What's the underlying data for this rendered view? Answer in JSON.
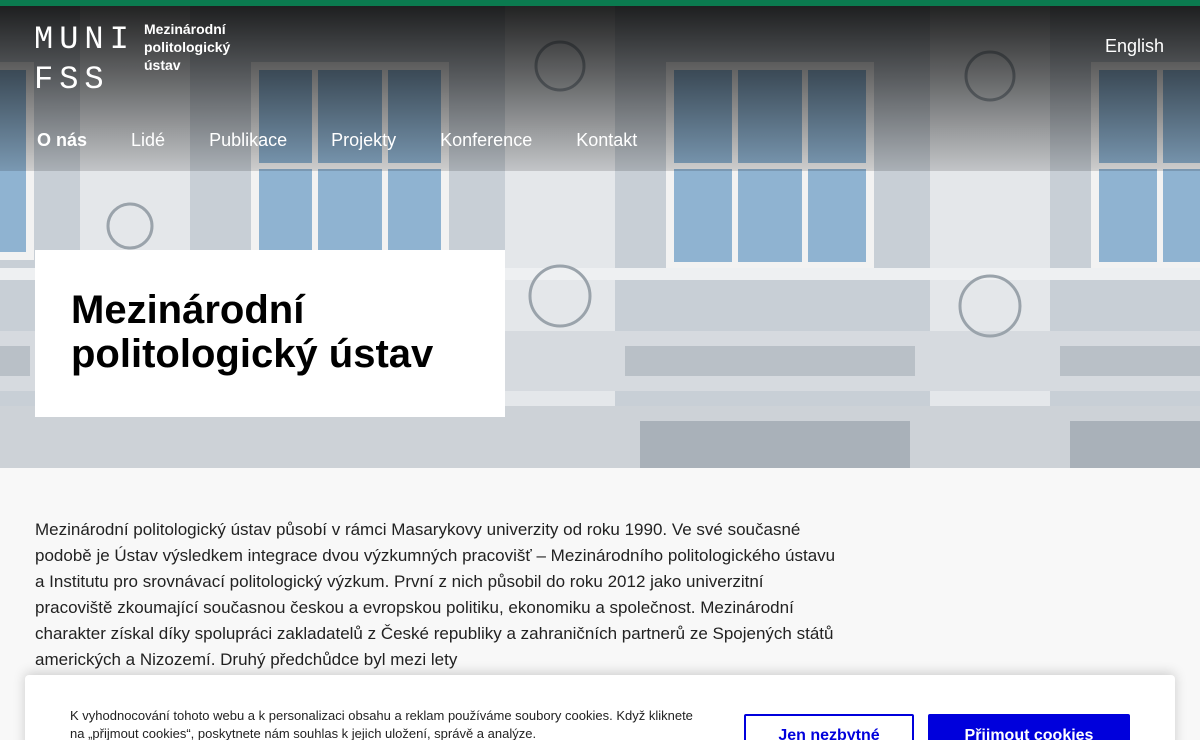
{
  "brand": {
    "logo_line1": "MUNI",
    "logo_line2": "FSS",
    "institute_name": "Mezinárodní politologický ústav",
    "accent_color": "#0b7a4f"
  },
  "header": {
    "language_link": "English"
  },
  "nav": {
    "items": [
      {
        "label": "O nás",
        "active": true
      },
      {
        "label": "Lidé"
      },
      {
        "label": "Publikace"
      },
      {
        "label": "Projekty"
      },
      {
        "label": "Konference"
      },
      {
        "label": "Kontakt"
      }
    ]
  },
  "hero": {
    "title": "Mezinárodní politologický ústav"
  },
  "main": {
    "intro": "Mezinárodní politologický ústav působí v rámci Masarykovy univerzity od roku 1990. Ve své současné podobě je Ústav výsledkem integrace dvou výzkumných pracovišť – Mezinárodního politologického ústavu a Institutu pro srovnávací politologický výzkum. První z nich působil do roku 2012 jako univerzitní pracoviště zkoumající současnou českou a evropskou politiku, ekonomiku a společnost. Mezinárodní charakter získal díky spolupráci zakladatelů z České republiky a zahraničních partnerů ze Spojených států amerických a Nizozemí. Druhý předchůdce byl mezi lety"
  },
  "cookie_banner": {
    "text": "K vyhodnocování tohoto webu a k personalizaci obsahu a reklam používáme soubory cookies. Když kliknete na „přijmout cookies“, poskytnete nám souhlas k jejich uložení, správě a analýze.",
    "necessary_label": "Jen nezbytné",
    "accept_label": "Přijmout cookies",
    "button_color": "#0000dc"
  }
}
